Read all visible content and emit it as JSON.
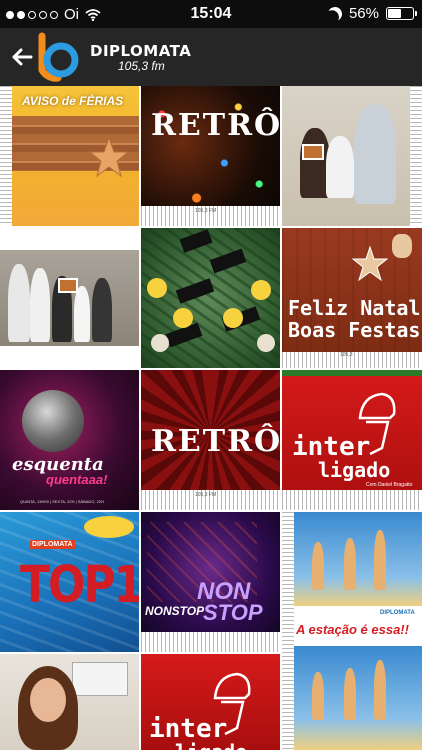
{
  "status_bar": {
    "carrier": "Oi",
    "time": "15:04",
    "battery_percent": "56%",
    "battery_level": 0.56
  },
  "header": {
    "brand_name": "DIPLOMATA",
    "brand_frequency": "105,3 fm",
    "colors": {
      "background": "#262626",
      "logo_orange": "#f28c1c",
      "logo_blue": "#2d9be0"
    }
  },
  "tiles": [
    {
      "id": "aviso-ferias",
      "title": "AVISO de FÉRIAS",
      "icon": "starfish-icon"
    },
    {
      "id": "retro-1",
      "title": "RETRÔ",
      "footer": "105,3 FM"
    },
    {
      "id": "team-photo-1",
      "title": ""
    },
    {
      "id": "family-photo",
      "title": ""
    },
    {
      "id": "christmas-tree",
      "title": ""
    },
    {
      "id": "feliz-natal",
      "title": "Feliz Natal",
      "subtitle": "Boas Festas",
      "footer": "105,3"
    },
    {
      "id": "esquenta",
      "title": "esquenta",
      "subtitle": "quentaaa!",
      "footer": "QUINTA, 13H00 | SEXTA, 22H | SÁBADO, 22H"
    },
    {
      "id": "retro-2",
      "title": "RETRÔ",
      "footer": "105,3 FM"
    },
    {
      "id": "interligado-1",
      "title": "inter",
      "subtitle": "ligado",
      "footer": "Com Daniel Bragatto"
    },
    {
      "id": "top10",
      "title": "TOP10",
      "brand": "DIPLOMATA"
    },
    {
      "id": "non-stop",
      "title": "NON",
      "subtitle": "STOP",
      "tag": "NONSTOP"
    },
    {
      "id": "estacao",
      "title": "A estação é essa!!",
      "brand": "DIPLOMATA"
    },
    {
      "id": "selfie",
      "title": ""
    },
    {
      "id": "interligado-2",
      "title": "inter",
      "subtitle": "ligado"
    }
  ]
}
